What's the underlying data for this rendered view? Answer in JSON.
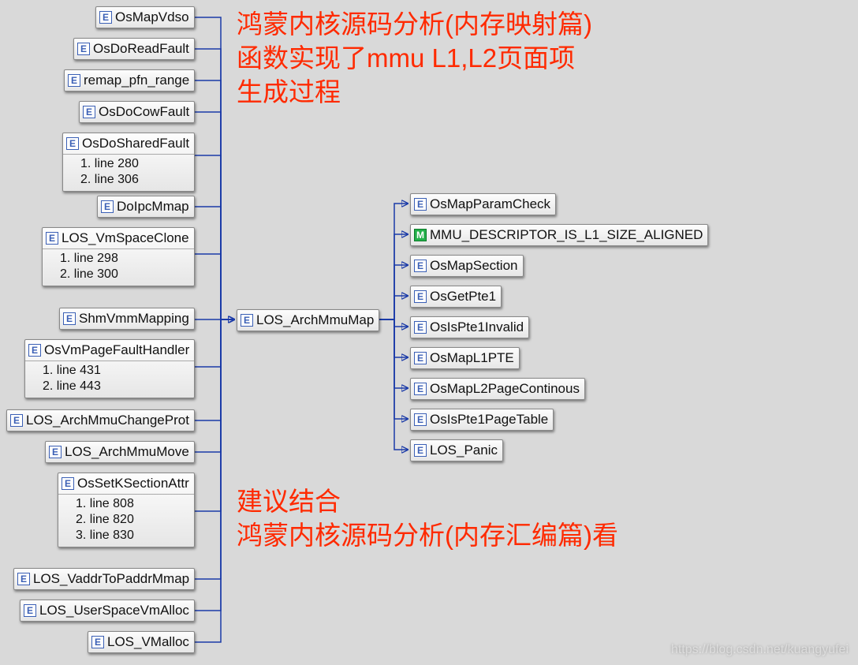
{
  "annotations": {
    "top": "鸿蒙内核源码分析(内存映射篇)\n函数实现了mmu L1,L2页面项\n生成过程",
    "bottom": "建议结合\n鸿蒙内核源码分析(内存汇编篇)看"
  },
  "center_node": {
    "label": "LOS_ArchMmuMap"
  },
  "left_nodes": [
    {
      "label": "OsMapVdso",
      "lines": []
    },
    {
      "label": "OsDoReadFault",
      "lines": []
    },
    {
      "label": "remap_pfn_range",
      "lines": []
    },
    {
      "label": "OsDoCowFault",
      "lines": []
    },
    {
      "label": "OsDoSharedFault",
      "lines": [
        "1. line 280",
        "2. line 306"
      ]
    },
    {
      "label": "DoIpcMmap",
      "lines": []
    },
    {
      "label": "LOS_VmSpaceClone",
      "lines": [
        "1. line 298",
        "2. line 300"
      ]
    },
    {
      "label": "ShmVmmMapping",
      "lines": []
    },
    {
      "label": "OsVmPageFaultHandler",
      "lines": [
        "1. line 431",
        "2. line 443"
      ]
    },
    {
      "label": "LOS_ArchMmuChangeProt",
      "lines": []
    },
    {
      "label": "LOS_ArchMmuMove",
      "lines": []
    },
    {
      "label": "OsSetKSectionAttr",
      "lines": [
        "1. line 808",
        "2. line 820",
        "3. line 830"
      ]
    },
    {
      "label": "LOS_VaddrToPaddrMmap",
      "lines": []
    },
    {
      "label": "LOS_UserSpaceVmAlloc",
      "lines": []
    },
    {
      "label": "LOS_VMalloc",
      "lines": []
    }
  ],
  "right_nodes": [
    {
      "label": "OsMapParamCheck",
      "ico": "E"
    },
    {
      "label": "MMU_DESCRIPTOR_IS_L1_SIZE_ALIGNED",
      "ico": "M"
    },
    {
      "label": "OsMapSection",
      "ico": "E"
    },
    {
      "label": "OsGetPte1",
      "ico": "E"
    },
    {
      "label": "OsIsPte1Invalid",
      "ico": "E"
    },
    {
      "label": "OsMapL1PTE",
      "ico": "E"
    },
    {
      "label": "OsMapL2PageContinous",
      "ico": "E"
    },
    {
      "label": "OsIsPte1PageTable",
      "ico": "E"
    },
    {
      "label": "LOS_Panic",
      "ico": "E"
    }
  ],
  "watermark": "https://blog.csdn.net/kuangyufei",
  "chart_data": {
    "type": "call-graph",
    "center": "LOS_ArchMmuMap",
    "callers": [
      "OsMapVdso",
      "OsDoReadFault",
      "remap_pfn_range",
      "OsDoCowFault",
      {
        "fn": "OsDoSharedFault",
        "lines": [
          280,
          306
        ]
      },
      "DoIpcMmap",
      {
        "fn": "LOS_VmSpaceClone",
        "lines": [
          298,
          300
        ]
      },
      "ShmVmmMapping",
      {
        "fn": "OsVmPageFaultHandler",
        "lines": [
          431,
          443
        ]
      },
      "LOS_ArchMmuChangeProt",
      "LOS_ArchMmuMove",
      {
        "fn": "OsSetKSectionAttr",
        "lines": [
          808,
          820,
          830
        ]
      },
      "LOS_VaddrToPaddrMmap",
      "LOS_UserSpaceVmAlloc",
      "LOS_VMalloc"
    ],
    "callees": [
      "OsMapParamCheck",
      "MMU_DESCRIPTOR_IS_L1_SIZE_ALIGNED",
      "OsMapSection",
      "OsGetPte1",
      "OsIsPte1Invalid",
      "OsMapL1PTE",
      "OsMapL2PageContinous",
      "OsIsPte1PageTable",
      "LOS_Panic"
    ]
  }
}
